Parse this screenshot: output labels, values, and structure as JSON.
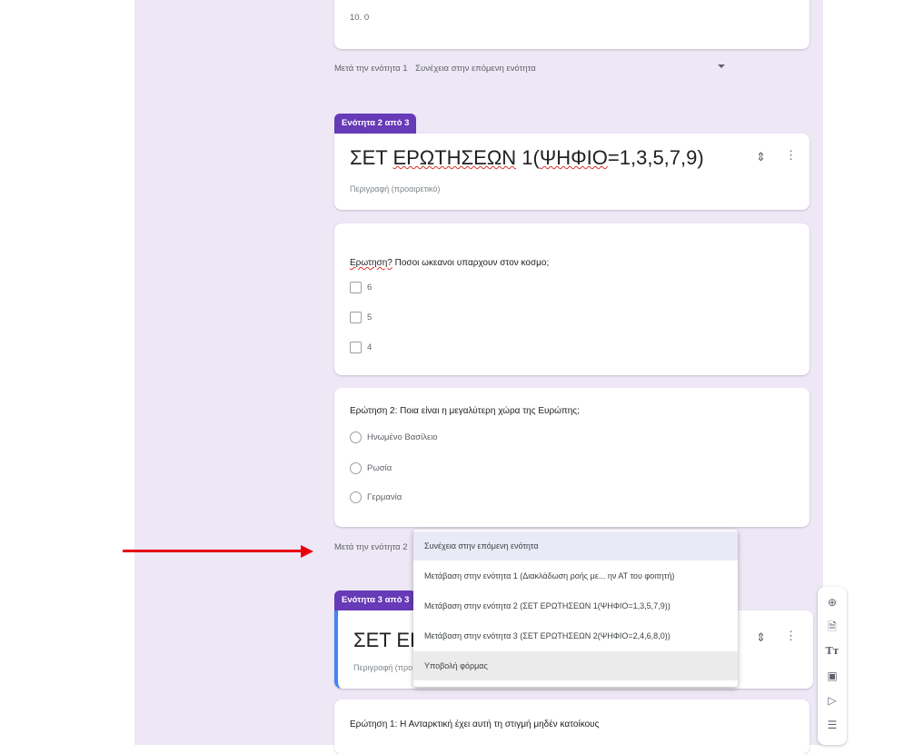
{
  "top_card": {
    "option": "10. 0"
  },
  "after_section_1": {
    "label": "Μετά την ενότητα 1",
    "value": "Συνέχεια στην επόμενη ενότητα"
  },
  "section2": {
    "tag": "Ενότητα 2 από 3",
    "title_prefix": "ΣΕΤ ",
    "title_word": "ΕΡΩΤΗΣΕΩΝ",
    "title_mid": " 1(",
    "title_word2": "ΨΗΦΙΟ",
    "title_suffix": "=1,3,5,7,9)",
    "description": "Περιγραφή (προαιρετικό)"
  },
  "question1": {
    "title_underlined": "Ερωτηση?",
    "title_rest": " Ποσοι ωκεανοι υπαρχουν στον κοσμο;",
    "options": [
      "6",
      "5",
      "4"
    ]
  },
  "question2": {
    "title": "Ερώτηση 2: Ποια είναι η μεγαλύτερη χώρα της Ευρώπης;",
    "options": [
      "Ηνωμένο Βασίλειο",
      "Ρωσία",
      "Γερμανία"
    ]
  },
  "after_section_2": {
    "label": "Μετά την ενότητα 2"
  },
  "section3": {
    "tag": "Ενότητα 3 από 3",
    "title": "ΣΕΤ ΕΡΩ",
    "description": "Περιγραφή (προ"
  },
  "question3": {
    "title": "Ερώτηση 1: Η Ανταρκτική έχει αυτή τη στιγμή μηδέν κατοίκους"
  },
  "menu": {
    "items": [
      "Συνέχεια στην επόμενη ενότητα",
      "Μετάβαση στην ενότητα 1 (Διακλάδωση ροής με... ην ΑΤ του φοιτητή)",
      "Μετάβαση στην ενότητα 2 (ΣΕΤ ΕΡΩΤΗΣΕΩΝ 1(ΨΗΦΙΟ=1,3,5,7,9))",
      "Μετάβαση στην ενότητα 3 (ΣΕΤ ΕΡΩΤΗΣΕΩΝ 2(ΨΗΦΙΟ=2,4,6,8,0))",
      "Υποβολή φόρμας"
    ]
  },
  "toolbar": {
    "icons": [
      "add-question-icon",
      "import-questions-icon",
      "add-title-icon",
      "add-image-icon",
      "add-video-icon",
      "add-section-icon"
    ],
    "title_glyph": "Tт"
  },
  "colors": {
    "accent": "#673ab7",
    "background": "#ede7f6",
    "arrow": "#e8000b"
  }
}
